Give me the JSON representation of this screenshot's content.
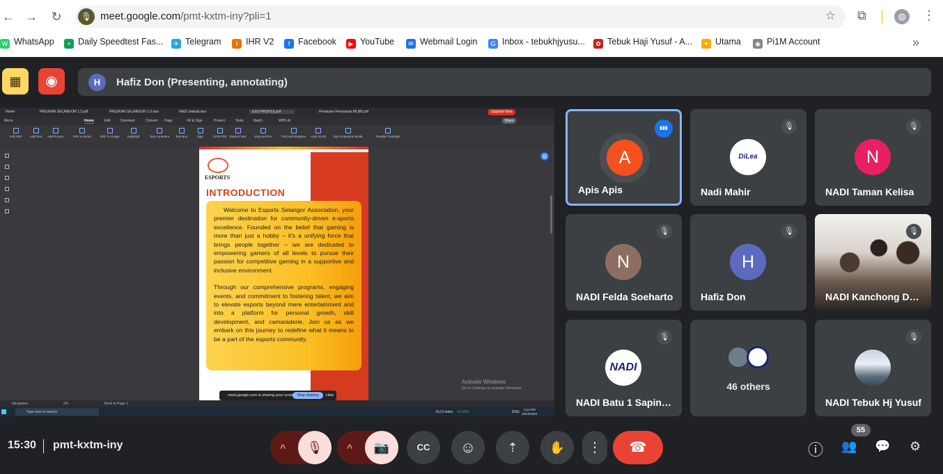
{
  "browser": {
    "url_host": "meet.google.com",
    "url_path": "/pmt-kxtm-iny?pli=1",
    "back_glyph": "←",
    "forward_glyph": "→",
    "reload_glyph": "↻",
    "mic_glyph": "🎙",
    "star_glyph": "☆",
    "ext_glyph": "⧉",
    "profile_glyph": "◍",
    "menu_glyph": "⋮",
    "overflow_glyph": "»"
  },
  "bookmarks": [
    {
      "label": "WhatsApp",
      "color": "#25d366",
      "glyph": "W"
    },
    {
      "label": "Daily Speedtest Fas...",
      "color": "#0f9d58",
      "glyph": "+"
    },
    {
      "label": "Telegram",
      "color": "#2aa3df",
      "glyph": "✈"
    },
    {
      "label": "IHR V2",
      "color": "#e8710a",
      "glyph": "I"
    },
    {
      "label": "Facebook",
      "color": "#1877f2",
      "glyph": "f"
    },
    {
      "label": "YouTube",
      "color": "#ff0000",
      "glyph": "▶"
    },
    {
      "label": "Webmail Login",
      "color": "#1a73e8",
      "glyph": "✉"
    },
    {
      "label": "Inbox - tebukhjyusu...",
      "color": "#4285f4",
      "glyph": "G"
    },
    {
      "label": "Tebuk Haji Yusuf - A...",
      "color": "#c5221f",
      "glyph": "✿"
    },
    {
      "label": "Utama",
      "color": "#f9ab00",
      "glyph": "✦"
    },
    {
      "label": "Pi1M Account",
      "color": "#80868b",
      "glyph": "◉"
    }
  ],
  "presenter": {
    "initial": "H",
    "label": "Hafiz Don (Presenting, annotating)",
    "hide_glyph": "▦",
    "rec_glyph": "◉"
  },
  "screen_share": {
    "tabs": [
      "Home",
      "PASUKAN SELANGOR 1.2.pdf",
      "PASUKAN SELANGOR 1.0.xlsx",
      "NADI Jeduall.xlsx",
      "ESS PROFILE.pdf",
      "Peraturan Permainan MLBB.pdf"
    ],
    "upgrade": "Upgrade Now",
    "menu": [
      "Menu",
      "Home",
      "Edit",
      "Comment",
      "Convert",
      "Page",
      "Fill & Sign",
      "Protect",
      "Tools",
      "Batch",
      "WPS AI"
    ],
    "share_btn": "Share",
    "toolbar": [
      "Edit PDF",
      "Add Text",
      "Add Picture",
      "PDF to Word",
      "PDF to Image",
      "Highlight",
      "Text comment",
      "Text Box",
      "Sign",
      "OCR PDF",
      "Extract Text",
      "Snip and Pin",
      "Find and Replace",
      "Auto Scroll",
      "Eye Protection Mode",
      "Parallel Translate"
    ],
    "doc": {
      "logo": "ESPORTS",
      "heading": "INTRODUCTION",
      "para1": "Welcome to Esports Selangor Association, your premier destination for community-driven e-sports excellence. Founded on the belief that gaming is more than just a hobby – it's a unifying force that brings people together – we are dedicated to empowering gamers of all levels to pursue their passion for competitive gaming in a supportive and inclusive environment.",
      "para2": "Through our comprehensive programs, engaging events, and commitment to fostering talent, we aim to elevate esports beyond mere entertainment and into a platform for personal growth, skill development, and camaraderie. Join us as we embark on this journey to redefine what it means to be a part of the esports community."
    },
    "activate_title": "Activate Windows",
    "activate_sub": "Go to Settings to activate Windows.",
    "sharing_text": "meet.google.com is sharing your screen.",
    "stop_sharing": "Stop sharing",
    "hide": "Hide",
    "status": {
      "nav": "Navigation",
      "page": "2/4",
      "back": "Back to Page 1"
    },
    "taskbar": {
      "search": "Type here to search",
      "klci": "KLCI index",
      "klci_val": "+0.55%",
      "lang": "ENG",
      "time": "3:14 PM",
      "date": "18/10/2024"
    }
  },
  "participants": [
    {
      "name": "Apis Apis",
      "initial": "A",
      "color": "#f4511e",
      "speaking": true
    },
    {
      "name": "Nadi Mahir",
      "initial": "DiLea",
      "color": "#ffffff",
      "logo": true
    },
    {
      "name": "NADI Taman Kelisa",
      "initial": "N",
      "color": "#e91e63"
    },
    {
      "name": "NADI Felda Soeharto",
      "initial": "N",
      "color": "#8d6e63"
    },
    {
      "name": "Hafiz Don",
      "initial": "H",
      "color": "#5c6bc0"
    },
    {
      "name": "NADI Kanchong Darat",
      "photo": true
    },
    {
      "name": "NADI Batu 1 Sapintas",
      "initial": "NADI",
      "color": "#ffffff",
      "logo": true
    },
    {
      "name": "46 others",
      "others": true
    },
    {
      "name": "NADI Tebuk Hj Yusuf",
      "photo_avatar": true
    }
  ],
  "bottom": {
    "time": "15:30",
    "code": "pmt-kxtm-iny",
    "people_count": "55",
    "chevron": "^",
    "mic_off": "🎙",
    "cam_off": "📷",
    "cc": "CC",
    "emoji": "☺",
    "present": "⇡",
    "hand": "✋",
    "more": "⋮",
    "hangup": "☎",
    "info": "ⓘ",
    "people": "👥",
    "chat": "💬",
    "activities": "⚙",
    "mute_glyph": "🎙",
    "speaking_glyph": "▮▮▮"
  },
  "colors": {
    "speaking_border": "#8ab4f8",
    "hangup": "#ea4335",
    "muted_bg": "#f9dedc",
    "muted_fg": "#601410",
    "accent_blue": "#1a73e8"
  }
}
